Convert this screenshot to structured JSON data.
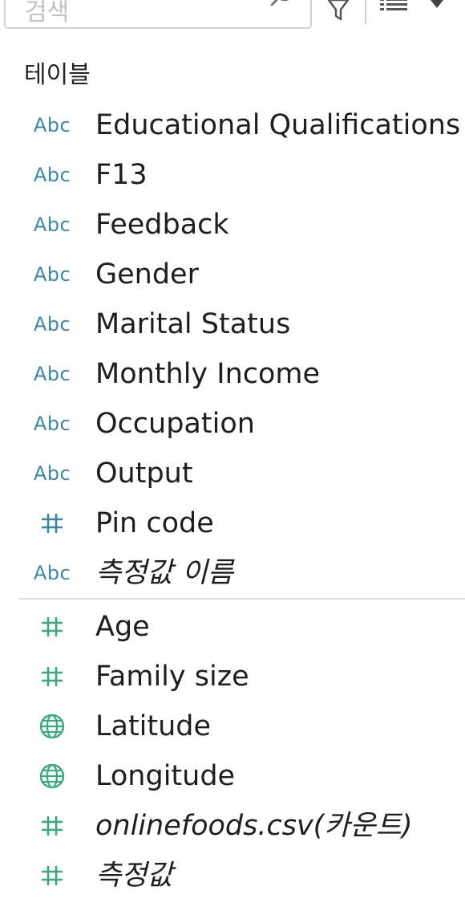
{
  "search": {
    "placeholder": "검색"
  },
  "section": {
    "title": "테이블"
  },
  "colors": {
    "dimension": "#3c88a3",
    "measure": "#3aaa80"
  },
  "dimensions": [
    {
      "name": "Educational Qualifications",
      "type": "Abc",
      "icon": "string-type-icon",
      "italic": false
    },
    {
      "name": "F13",
      "type": "Abc",
      "icon": "string-type-icon",
      "italic": false
    },
    {
      "name": "Feedback",
      "type": "Abc",
      "icon": "string-type-icon",
      "italic": false
    },
    {
      "name": "Gender",
      "type": "Abc",
      "icon": "string-type-icon",
      "italic": false
    },
    {
      "name": "Marital Status",
      "type": "Abc",
      "icon": "string-type-icon",
      "italic": false
    },
    {
      "name": "Monthly Income",
      "type": "Abc",
      "icon": "string-type-icon",
      "italic": false
    },
    {
      "name": "Occupation",
      "type": "Abc",
      "icon": "string-type-icon",
      "italic": false
    },
    {
      "name": "Output",
      "type": "Abc",
      "icon": "string-type-icon",
      "italic": false
    },
    {
      "name": "Pin code",
      "type": "#",
      "icon": "number-type-icon",
      "italic": false
    },
    {
      "name": "측정값 이름",
      "type": "Abc",
      "icon": "string-type-icon",
      "italic": true
    }
  ],
  "measures": [
    {
      "name": "Age",
      "type": "#",
      "icon": "number-type-icon",
      "italic": false
    },
    {
      "name": "Family size",
      "type": "#",
      "icon": "number-type-icon",
      "italic": false
    },
    {
      "name": "Latitude",
      "type": "geo",
      "icon": "globe-icon",
      "italic": false
    },
    {
      "name": "Longitude",
      "type": "geo",
      "icon": "globe-icon",
      "italic": false
    },
    {
      "name": "onlinefoods.csv(카운트)",
      "type": "#",
      "icon": "number-type-icon",
      "italic": true
    },
    {
      "name": "측정값",
      "type": "#",
      "icon": "number-type-icon",
      "italic": true
    }
  ]
}
